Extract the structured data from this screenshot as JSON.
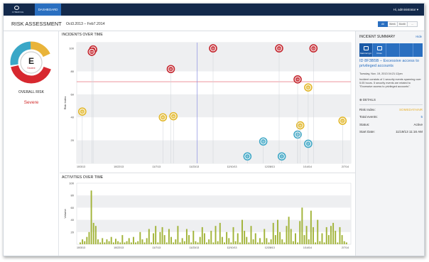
{
  "app": {
    "logo_text": "CYBERVUE",
    "tab": "DASHBOARD",
    "user": "Hi, administrator"
  },
  "header": {
    "title": "RISK ASSESSMENT",
    "date_range": "Oct3.2013 – Feb7.2014",
    "range_tabs": [
      "All",
      "Week",
      "Month",
      "..."
    ]
  },
  "left": {
    "grade": "E",
    "grade_sub": "Severe",
    "overall_label": "OVERALL RISK",
    "overall_value": "Severe"
  },
  "incidents": {
    "title": "INCIDENTS OVER TIME",
    "ylabel": "Risk Index",
    "yticks": [
      "100",
      "80",
      "60",
      "40",
      "20"
    ],
    "xticks": [
      "10/3/13",
      "10/22/13",
      "11/7/13",
      "11/23/13",
      "12/10/13",
      "12/28/13",
      "1/14/14",
      "2/7/14"
    ],
    "threshold_color": "#e05560"
  },
  "activities": {
    "title": "ACTIVITIES OVER TIME",
    "ylabel": "Volume",
    "yticks": [
      "100",
      "80",
      "60",
      "40",
      "20"
    ],
    "xticks": [
      "10/3/13",
      "10/22/13",
      "11/7/13",
      "11/23/13",
      "12/10/13",
      "12/28/13",
      "1/14/14",
      "2/7/14"
    ],
    "bar_color": "#a2b43a"
  },
  "chart_data": [
    {
      "type": "scatter",
      "title": "INCIDENTS OVER TIME",
      "ylabel": "Risk Index",
      "ylim": [
        0,
        105
      ],
      "xlim": [
        0,
        100
      ],
      "threshold": 71,
      "cursor_x": 44,
      "points": [
        {
          "x": 4.6,
          "y": 99,
          "label": "100",
          "sev": "red"
        },
        {
          "x": 4.1,
          "y": 97,
          "label": "100",
          "sev": "red"
        },
        {
          "x": 0.5,
          "y": 45,
          "label": "45",
          "sev": "yellow"
        },
        {
          "x": 34,
          "y": 82,
          "label": "82",
          "sev": "red"
        },
        {
          "x": 31,
          "y": 40,
          "label": "40",
          "sev": "yellow"
        },
        {
          "x": 35,
          "y": 41,
          "label": "40",
          "sev": "yellow"
        },
        {
          "x": 50,
          "y": 100,
          "label": "100",
          "sev": "red"
        },
        {
          "x": 63,
          "y": 6,
          "label": "6",
          "sev": "blue"
        },
        {
          "x": 69,
          "y": 19,
          "label": "19",
          "sev": "blue"
        },
        {
          "x": 75,
          "y": 100,
          "label": "100",
          "sev": "red"
        },
        {
          "x": 76,
          "y": 6,
          "label": "5",
          "sev": "blue"
        },
        {
          "x": 82,
          "y": 25,
          "label": "25",
          "sev": "blue"
        },
        {
          "x": 83,
          "y": 33,
          "label": "33",
          "sev": "yellow"
        },
        {
          "x": 82,
          "y": 73,
          "label": "73",
          "sev": "red"
        },
        {
          "x": 86,
          "y": 66,
          "label": "66",
          "sev": "yellow"
        },
        {
          "x": 86,
          "y": 17,
          "label": "17",
          "sev": "blue"
        },
        {
          "x": 88,
          "y": 100,
          "label": "100",
          "sev": "red"
        },
        {
          "x": 99,
          "y": 37,
          "label": "37",
          "sev": "yellow"
        }
      ]
    },
    {
      "type": "bar",
      "title": "ACTIVITIES OVER TIME",
      "ylabel": "Volume",
      "ylim": [
        0,
        100
      ],
      "values": [
        3,
        8,
        5,
        12,
        20,
        88,
        35,
        30,
        8,
        3,
        10,
        3,
        8,
        5,
        12,
        3,
        9,
        5,
        3,
        15,
        3,
        5,
        10,
        3,
        12,
        3,
        5,
        20,
        8,
        3,
        10,
        25,
        3,
        18,
        30,
        3,
        20,
        28,
        15,
        3,
        25,
        12,
        3,
        8,
        30,
        3,
        10,
        5,
        25,
        15,
        3,
        22,
        5,
        3,
        12,
        28,
        18,
        3,
        8,
        22,
        3,
        30,
        5,
        35,
        12,
        3,
        20,
        10,
        3,
        28,
        5,
        18,
        3,
        40,
        22,
        12,
        3,
        30,
        8,
        18,
        3,
        10,
        3,
        25,
        10,
        3,
        8,
        35,
        15,
        40,
        20,
        8,
        3,
        30,
        45,
        25,
        5,
        18,
        3,
        38,
        60,
        15,
        30,
        8,
        55,
        28,
        3,
        40,
        5,
        18,
        3,
        28,
        15,
        30,
        35,
        22,
        3,
        28,
        15,
        5,
        3
      ]
    }
  ],
  "summary": {
    "title": "INCIDENT SUMMARY",
    "hide": "Hide",
    "buttons": [
      "Mark Ecrypt",
      "Close",
      "",
      ""
    ],
    "id_text": "ID 8F3B5B – Excessive access to privileged accounts",
    "time": "Tuesday, Nov. 19, 2013 04:21:12pm",
    "desc": "Incident consists of 1 security events spanning over 5.05 hours. 5 security events are related to \"Excessive access to privileged accounts\".",
    "details_label": "DETAILS",
    "rows": [
      {
        "k": "Risk Index:",
        "v": "SOMEDATAINR",
        "color": "#e8b12d"
      },
      {
        "k": "Total events:",
        "v": "5",
        "color": "#2a6fc0"
      },
      {
        "k": "Status:",
        "v": "Active",
        "color": "#333"
      },
      {
        "k": "Start Date:",
        "v": "11/19/13 11:16 AM",
        "color": "#333"
      }
    ]
  },
  "colors": {
    "red": "#c4262e",
    "yellow": "#e2b72a",
    "blue": "#3fa7c6",
    "accent": "#2a6fc0",
    "nav": "#13294b"
  }
}
